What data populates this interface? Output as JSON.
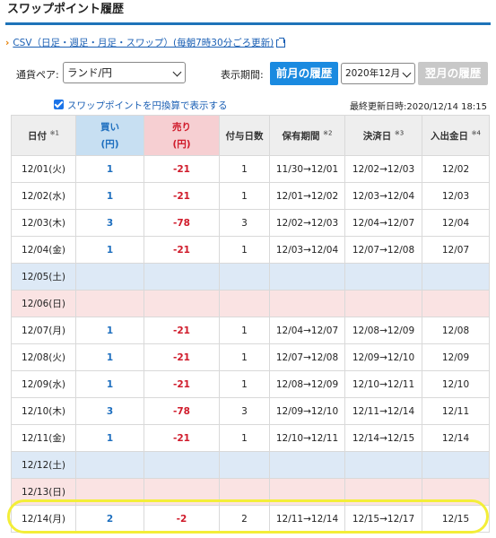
{
  "page_title": "スワップポイント履歴",
  "csv_link": "CSV（日足・週足・月足・スワップ）(毎朝7時30分ごろ更新)",
  "controls": {
    "currency_label": "通貨ペア:",
    "currency_value": "ランド/円",
    "period_label": "表示期間:",
    "prev_button": "前月の履歴",
    "month_value": "2020年12月",
    "next_button": "翌月の履歴"
  },
  "option": {
    "checkbox_label": "スワップポイントを円換算で表示する",
    "checked": true,
    "last_updated": "最終更新日時:2020/12/14 18:15"
  },
  "table": {
    "headers": {
      "date": "日付",
      "date_note": "※1",
      "buy": "買い",
      "buy_unit": "(円)",
      "sell": "売り",
      "sell_unit": "(円)",
      "days": "付与日数",
      "hold": "保有期間",
      "hold_note": "※2",
      "settle": "決済日",
      "settle_note": "※3",
      "cash": "入出金日",
      "cash_note": "※4"
    },
    "rows": [
      {
        "date": "12/01(火)",
        "buy": "1",
        "sell": "-21",
        "days": "1",
        "hold": "11/30→12/01",
        "settle": "12/02→12/03",
        "cash": "12/02",
        "kind": ""
      },
      {
        "date": "12/02(水)",
        "buy": "1",
        "sell": "-21",
        "days": "1",
        "hold": "12/01→12/02",
        "settle": "12/03→12/04",
        "cash": "12/03",
        "kind": ""
      },
      {
        "date": "12/03(木)",
        "buy": "3",
        "sell": "-78",
        "days": "3",
        "hold": "12/02→12/03",
        "settle": "12/04→12/07",
        "cash": "12/04",
        "kind": ""
      },
      {
        "date": "12/04(金)",
        "buy": "1",
        "sell": "-21",
        "days": "1",
        "hold": "12/03→12/04",
        "settle": "12/07→12/08",
        "cash": "12/07",
        "kind": ""
      },
      {
        "date": "12/05(土)",
        "buy": "",
        "sell": "",
        "days": "",
        "hold": "",
        "settle": "",
        "cash": "",
        "kind": "sat"
      },
      {
        "date": "12/06(日)",
        "buy": "",
        "sell": "",
        "days": "",
        "hold": "",
        "settle": "",
        "cash": "",
        "kind": "sun"
      },
      {
        "date": "12/07(月)",
        "buy": "1",
        "sell": "-21",
        "days": "1",
        "hold": "12/04→12/07",
        "settle": "12/08→12/09",
        "cash": "12/08",
        "kind": ""
      },
      {
        "date": "12/08(火)",
        "buy": "1",
        "sell": "-21",
        "days": "1",
        "hold": "12/07→12/08",
        "settle": "12/09→12/10",
        "cash": "12/09",
        "kind": ""
      },
      {
        "date": "12/09(水)",
        "buy": "1",
        "sell": "-21",
        "days": "1",
        "hold": "12/08→12/09",
        "settle": "12/10→12/11",
        "cash": "12/10",
        "kind": ""
      },
      {
        "date": "12/10(木)",
        "buy": "3",
        "sell": "-78",
        "days": "3",
        "hold": "12/09→12/10",
        "settle": "12/11→12/14",
        "cash": "12/11",
        "kind": ""
      },
      {
        "date": "12/11(金)",
        "buy": "1",
        "sell": "-21",
        "days": "1",
        "hold": "12/10→12/11",
        "settle": "12/14→12/15",
        "cash": "12/14",
        "kind": ""
      },
      {
        "date": "12/12(土)",
        "buy": "",
        "sell": "",
        "days": "",
        "hold": "",
        "settle": "",
        "cash": "",
        "kind": "sat"
      },
      {
        "date": "12/13(日)",
        "buy": "",
        "sell": "",
        "days": "",
        "hold": "",
        "settle": "",
        "cash": "",
        "kind": "sun"
      },
      {
        "date": "12/14(月)",
        "buy": "2",
        "sell": "-2",
        "days": "2",
        "hold": "12/11→12/14",
        "settle": "12/15→12/17",
        "cash": "12/15",
        "kind": ""
      }
    ]
  },
  "colors": {
    "accent": "#1a8ae0",
    "buy": "#1e6fbf",
    "sell": "#d01b2b",
    "highlight": "#f3ee38"
  }
}
